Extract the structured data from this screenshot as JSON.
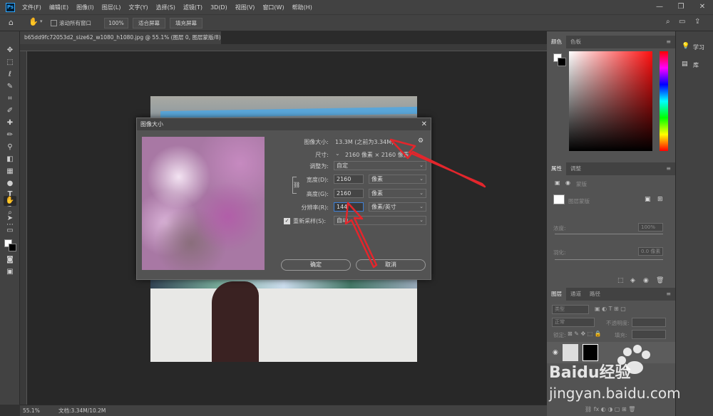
{
  "app": {
    "logo": "Ps"
  },
  "menu": [
    "文件(F)",
    "编辑(E)",
    "图像(I)",
    "图层(L)",
    "文字(Y)",
    "选择(S)",
    "滤镜(T)",
    "3D(D)",
    "视图(V)",
    "窗口(W)",
    "帮助(H)"
  ],
  "options_bar": {
    "scroll_all": "滚动所有窗口",
    "zoom": "100%",
    "fit_screen": "适合屏幕",
    "fill_screen": "填充屏幕"
  },
  "document_tab": "b65dd9fc72053d2_size62_w1080_h1080.jpg @ 55.1% (图层 0, 图层蒙版/8) *",
  "status": {
    "zoom": "55.1%",
    "doc": "文档:3.34M/10.2M"
  },
  "panels": {
    "color_tabs": [
      "颜色",
      "色板"
    ],
    "properties_tabs": [
      "属性",
      "调整"
    ],
    "properties_title": "蒙版",
    "layer_mask_label": "图层蒙版",
    "density_label": "浓度:",
    "density_value": "100%",
    "feather_label": "羽化:",
    "feather_value": "0.0 像素",
    "layers_tabs": [
      "图层",
      "通道",
      "路径"
    ],
    "layer_kind": "类型",
    "blend_mode": "正常",
    "opacity_label": "不透明度:",
    "lock_label": "锁定:",
    "fill_label": "填充:"
  },
  "dock": {
    "learn": "学习",
    "library": "库"
  },
  "dialog": {
    "title": "图像大小",
    "image_size_label": "图像大小:",
    "image_size_value": "13.3M (之前为3.34M)",
    "dimensions_label": "尺寸:",
    "dimensions_value": "2160 像素 × 2160 像素",
    "fit_label": "调整为:",
    "fit_value": "自定",
    "width_label": "宽度(D):",
    "width_value": "2160",
    "width_unit": "像素",
    "height_label": "高度(G):",
    "height_value": "2160",
    "height_unit": "像素",
    "resolution_label": "分辨率(R):",
    "resolution_value": "144",
    "resolution_unit": "像素/英寸",
    "resample_label": "重新采样(S):",
    "resample_value": "自动",
    "ok": "确定",
    "cancel": "取消"
  },
  "watermark": {
    "brand": "Baidu经验",
    "url": "jingyan.baidu.com"
  },
  "colors": {
    "arrow": "#e3262c",
    "accent": "#31a8ff"
  }
}
